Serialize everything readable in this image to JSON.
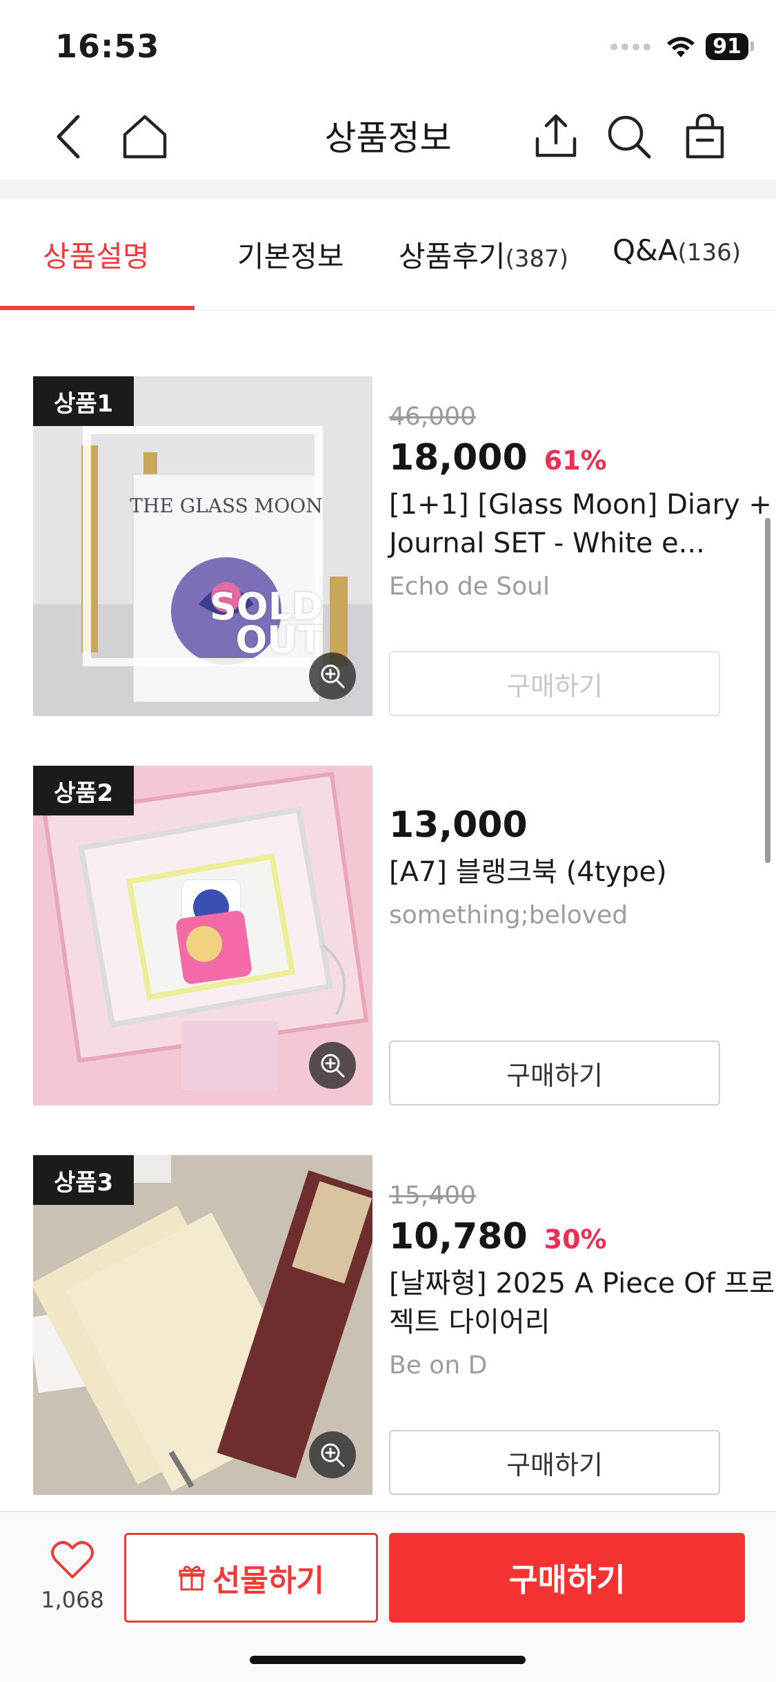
{
  "status_bar": {
    "time": "16:53",
    "battery": "91"
  },
  "header": {
    "title": "상품정보",
    "icons": [
      "back-icon",
      "home-icon",
      "share-icon",
      "search-icon",
      "shopping-bag-icon"
    ]
  },
  "tabs": [
    {
      "label": "상품설명",
      "count": "",
      "active": true
    },
    {
      "label": "기본정보",
      "count": ""
    },
    {
      "label": "상품후기",
      "count": "(387)"
    },
    {
      "label": "Q&A",
      "count": "(136)"
    }
  ],
  "products": [
    {
      "badge": "상품1",
      "original_price": "46,000",
      "price": "18,000",
      "discount": "61%",
      "name": "[1+1] [Glass Moon] Diary + Journal SET - White e...",
      "seller": "Echo de Soul",
      "buy_label": "구매하기",
      "sold_out": "SOLD OUT",
      "cover_text": "THE GLASS MOON"
    },
    {
      "badge": "상품2",
      "original_price": "",
      "price": "13,000",
      "discount": "",
      "name": "[A7] 블랭크북 (4type)",
      "seller": "something;beloved",
      "buy_label": "구매하기"
    },
    {
      "badge": "상품3",
      "original_price": "15,400",
      "price": "10,780",
      "discount": "30%",
      "name": "[날짜형] 2025 A Piece Of 프로젝트 다이어리",
      "seller": "Be on D",
      "buy_label": "구매하기"
    }
  ],
  "bottom_bar": {
    "like_count": "1,068",
    "gift_label": "선물하기",
    "buy_label": "구매하기"
  },
  "colors": {
    "accent": "#f53232",
    "discount": "#ee2e55"
  }
}
